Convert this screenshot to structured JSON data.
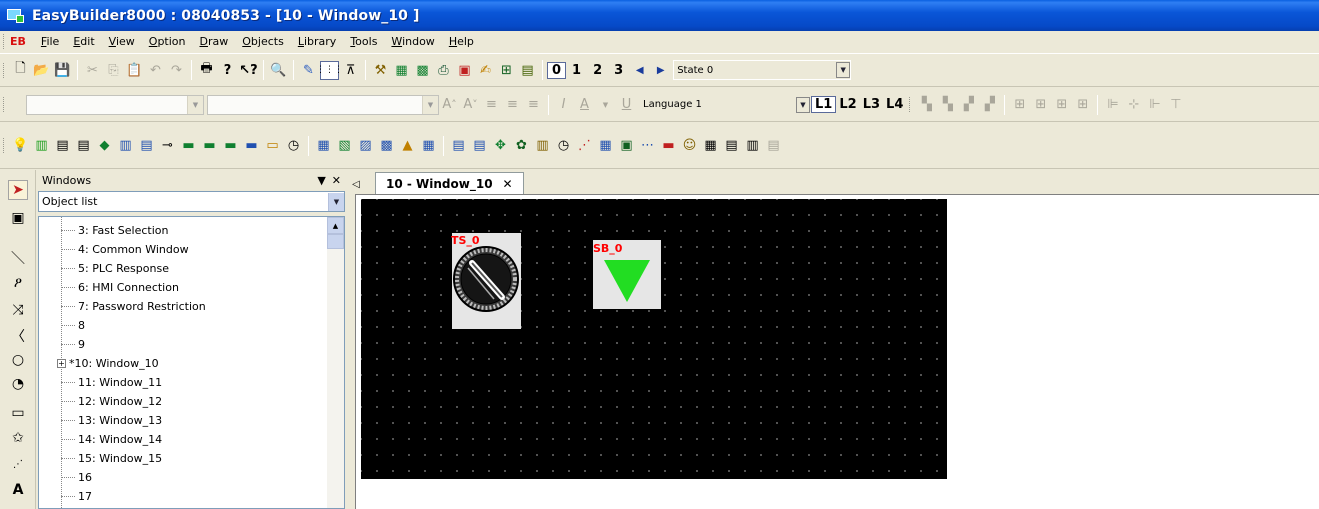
{
  "window": {
    "title": "EasyBuilder8000 : 08040853 - [10 - Window_10 ]"
  },
  "menubar": {
    "logo": "EB",
    "items": [
      {
        "label": "File",
        "underline": "F",
        "rest": "ile"
      },
      {
        "label": "Edit",
        "underline": "E",
        "rest": "dit"
      },
      {
        "label": "View",
        "underline": "V",
        "rest": "iew"
      },
      {
        "label": "Option",
        "underline": "O",
        "rest": "ption"
      },
      {
        "label": "Draw",
        "underline": "D",
        "rest": "raw"
      },
      {
        "label": "Objects",
        "underline": "O",
        "rest": "bjects"
      },
      {
        "label": "Library",
        "underline": "L",
        "rest": "ibrary"
      },
      {
        "label": "Tools",
        "underline": "T",
        "rest": "ools"
      },
      {
        "label": "Window",
        "underline": "W",
        "rest": "indow"
      },
      {
        "label": "Help",
        "underline": "H",
        "rest": "elp"
      }
    ]
  },
  "toolbar1": {
    "state_buttons": [
      "0",
      "1",
      "2",
      "3"
    ],
    "state_select": "State 0"
  },
  "toolbar2": {
    "language_select": "Language 1",
    "layers": [
      "L1",
      "L2",
      "L3",
      "L4"
    ]
  },
  "panel": {
    "title": "Windows",
    "combo_value": "Object list",
    "tree_items": [
      "3: Fast Selection",
      "4: Common Window",
      "5: PLC Response",
      "6: HMI Connection",
      "7: Password Restriction",
      "8",
      "9",
      "*10: Window_10",
      "11: Window_11",
      "12: Window_12",
      "13: Window_13",
      "14: Window_14",
      "15: Window_15",
      "16",
      "17"
    ]
  },
  "editor": {
    "tab_label": "10 - Window_10",
    "objects": [
      {
        "id": "TS_0",
        "label": "TS_0",
        "kind": "selector-switch"
      },
      {
        "id": "SB_0",
        "label": "SB_0",
        "kind": "set-bit-triangle",
        "color": "#22dd22"
      }
    ]
  },
  "colors": {
    "titlebar": "#0a56d8",
    "canvas": "#000000",
    "accent_green": "#22dd22",
    "label_red": "#ff0000"
  },
  "icons": {
    "toolbar1": [
      "new-file-icon",
      "open-folder-icon",
      "save-icon",
      "cut-icon",
      "copy-icon",
      "paste-icon",
      "undo-icon",
      "redo-icon",
      "print-icon",
      "help-icon",
      "context-help-icon",
      "find-icon",
      "pencil-icon",
      "grid-icon",
      "align-icon",
      "build-tools-icon",
      "compile-icon",
      "simulate-icon",
      "download-icon",
      "offline-icon",
      "online-icon",
      "tag-icon",
      "table-icon"
    ],
    "left_tools": [
      "pointer-icon",
      "property-icon",
      "line-icon",
      "polyline-icon",
      "x-mark-icon",
      "arc-icon",
      "circle-icon",
      "pie-icon",
      "rectangle-icon",
      "star-icon",
      "scale-icon",
      "text-icon"
    ]
  }
}
